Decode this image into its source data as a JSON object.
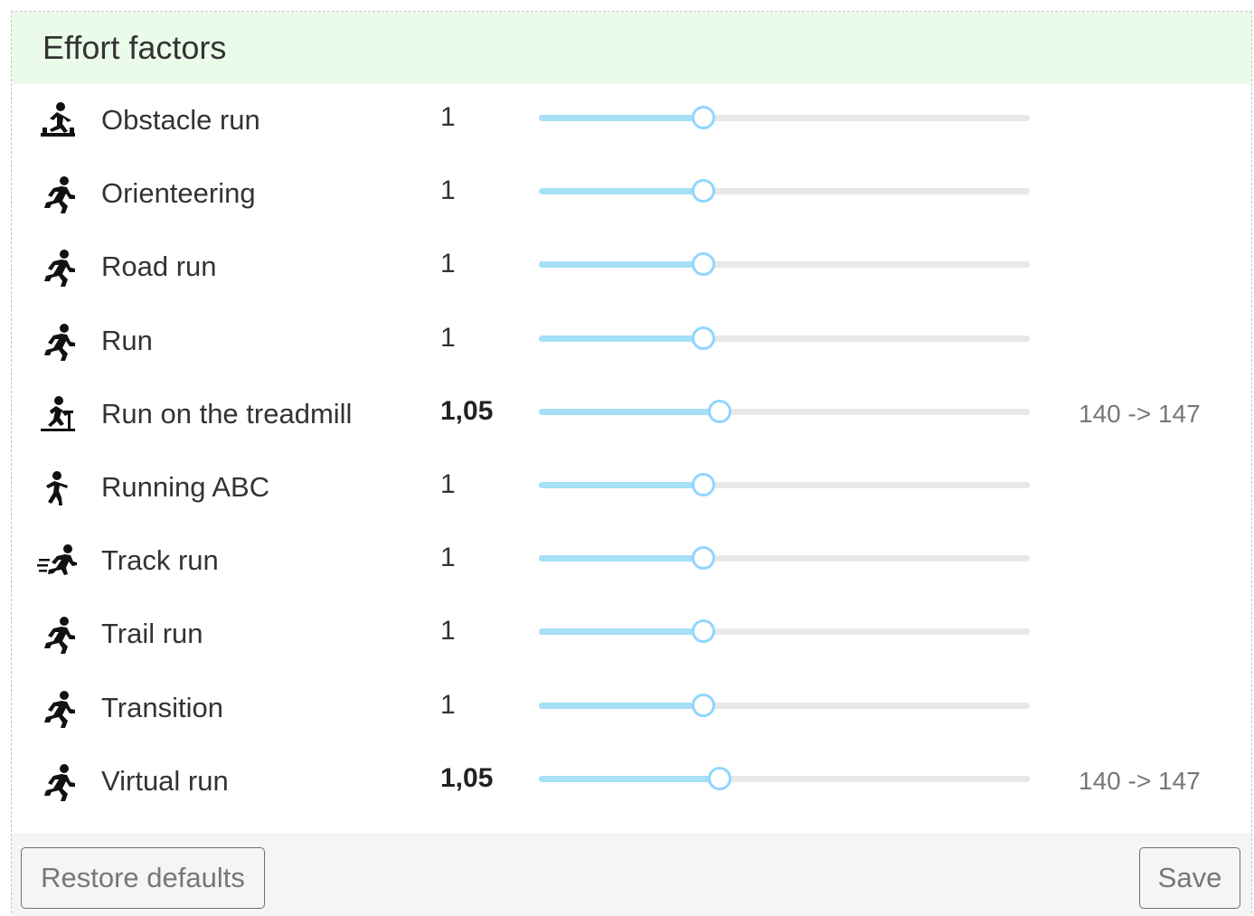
{
  "panel": {
    "title": "Effort factors"
  },
  "slider": {
    "min": 0.5,
    "max": 2.0
  },
  "rows": [
    {
      "icon": "obstacle-run-icon",
      "label": "Obstacle run",
      "value_text": "1",
      "value": 1,
      "bold": false,
      "delta": ""
    },
    {
      "icon": "orienteering-icon",
      "label": "Orienteering",
      "value_text": "1",
      "value": 1,
      "bold": false,
      "delta": ""
    },
    {
      "icon": "road-run-icon",
      "label": "Road run",
      "value_text": "1",
      "value": 1,
      "bold": false,
      "delta": ""
    },
    {
      "icon": "run-icon",
      "label": "Run",
      "value_text": "1",
      "value": 1,
      "bold": false,
      "delta": ""
    },
    {
      "icon": "treadmill-run-icon",
      "label": "Run on the treadmill",
      "value_text": "1,05",
      "value": 1.05,
      "bold": true,
      "delta": "140 -> 147"
    },
    {
      "icon": "running-abc-icon",
      "label": "Running ABC",
      "value_text": "1",
      "value": 1,
      "bold": false,
      "delta": ""
    },
    {
      "icon": "track-run-icon",
      "label": "Track run",
      "value_text": "1",
      "value": 1,
      "bold": false,
      "delta": ""
    },
    {
      "icon": "trail-run-icon",
      "label": "Trail run",
      "value_text": "1",
      "value": 1,
      "bold": false,
      "delta": ""
    },
    {
      "icon": "transition-icon",
      "label": "Transition",
      "value_text": "1",
      "value": 1,
      "bold": false,
      "delta": ""
    },
    {
      "icon": "virtual-run-icon",
      "label": "Virtual run",
      "value_text": "1,05",
      "value": 1.05,
      "bold": true,
      "delta": "140 -> 147"
    }
  ],
  "footer": {
    "restore_label": "Restore defaults",
    "save_label": "Save"
  },
  "colors": {
    "header_bg": "#eafbea",
    "slider_fill": "#a6e0f6",
    "slider_track": "#e8e8e8",
    "handle_border": "#91d5ff"
  }
}
